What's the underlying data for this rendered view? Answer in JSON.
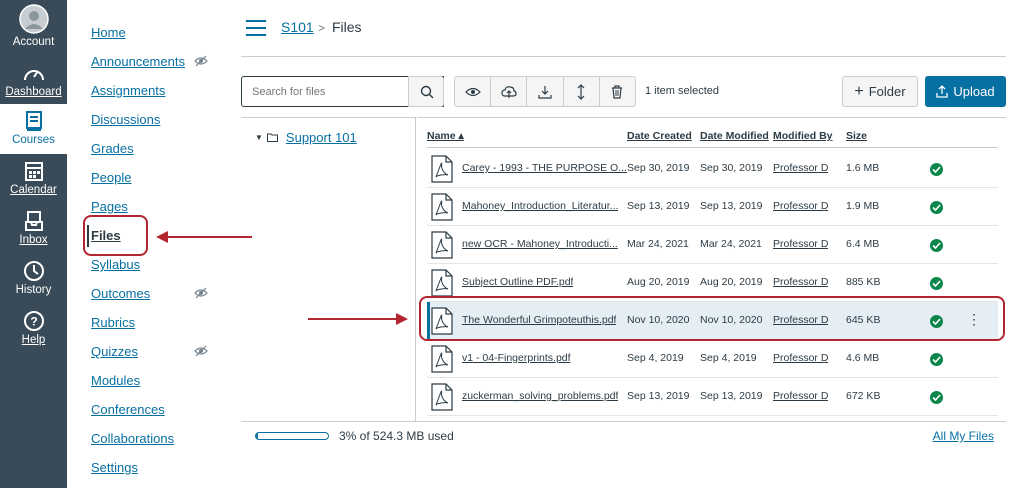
{
  "global_nav": {
    "items": [
      {
        "label": "Account",
        "icon": "account-icon"
      },
      {
        "label": "Dashboard",
        "icon": "dashboard-icon"
      },
      {
        "label": "Courses",
        "icon": "courses-icon"
      },
      {
        "label": "Calendar",
        "icon": "calendar-icon"
      },
      {
        "label": "Inbox",
        "icon": "inbox-icon"
      },
      {
        "label": "History",
        "icon": "history-icon"
      },
      {
        "label": "Help",
        "icon": "help-icon"
      }
    ]
  },
  "course_nav": {
    "items": [
      {
        "label": "Home"
      },
      {
        "label": "Announcements",
        "hidden": true
      },
      {
        "label": "Assignments"
      },
      {
        "label": "Discussions"
      },
      {
        "label": "Grades"
      },
      {
        "label": "People"
      },
      {
        "label": "Pages"
      },
      {
        "label": "Files",
        "active": true
      },
      {
        "label": "Syllabus"
      },
      {
        "label": "Outcomes",
        "hidden": true
      },
      {
        "label": "Rubrics"
      },
      {
        "label": "Quizzes",
        "hidden": true
      },
      {
        "label": "Modules"
      },
      {
        "label": "Conferences"
      },
      {
        "label": "Collaborations"
      },
      {
        "label": "Settings"
      }
    ]
  },
  "breadcrumb": {
    "course": "S101",
    "separator": ">",
    "current": "Files"
  },
  "toolbar": {
    "search_placeholder": "Search for files",
    "selection_status": "1 item selected",
    "folder_label": "Folder",
    "upload_label": "Upload"
  },
  "tree": {
    "root": "Support 101"
  },
  "columns": {
    "name": "Name ▴",
    "created": "Date Created",
    "modified": "Date Modified",
    "modified_by": "Modified By",
    "size": "Size"
  },
  "files": [
    {
      "name": "Carey - 1993 - THE PURPOSE O...",
      "created": "Sep 30, 2019",
      "modified": "Sep 30, 2019",
      "modified_by": "Professor D",
      "size": "1.6 MB"
    },
    {
      "name": "Mahoney_Introduction_Literatur...",
      "created": "Sep 13, 2019",
      "modified": "Sep 13, 2019",
      "modified_by": "Professor D",
      "size": "1.9 MB"
    },
    {
      "name": "new OCR - Mahoney_Introducti...",
      "created": "Mar 24, 2021",
      "modified": "Mar 24, 2021",
      "modified_by": "Professor D",
      "size": "6.4 MB"
    },
    {
      "name": "Subject Outline PDF.pdf",
      "created": "Aug 20, 2019",
      "modified": "Aug 20, 2019",
      "modified_by": "Professor D",
      "size": "885 KB"
    },
    {
      "name": "The Wonderful Grimpoteuthis.pdf",
      "created": "Nov 10, 2020",
      "modified": "Nov 10, 2020",
      "modified_by": "Professor D",
      "size": "645 KB",
      "selected": true
    },
    {
      "name": "v1 - 04-Fingerprints.pdf",
      "created": "Sep 4, 2019",
      "modified": "Sep 4, 2019",
      "modified_by": "Professor D",
      "size": "4.6 MB"
    },
    {
      "name": "zuckerman_solving_problems.pdf",
      "created": "Sep 13, 2019",
      "modified": "Sep 13, 2019",
      "modified_by": "Professor D",
      "size": "672 KB"
    }
  ],
  "footer": {
    "quota_text": "3% of 524.3 MB used",
    "quota_fraction": 0.03,
    "all_files": "All My Files"
  },
  "colors": {
    "nav_bg": "#394b58",
    "link": "#0770a3",
    "published": "#0b874b",
    "annotation": "#b3262f"
  }
}
